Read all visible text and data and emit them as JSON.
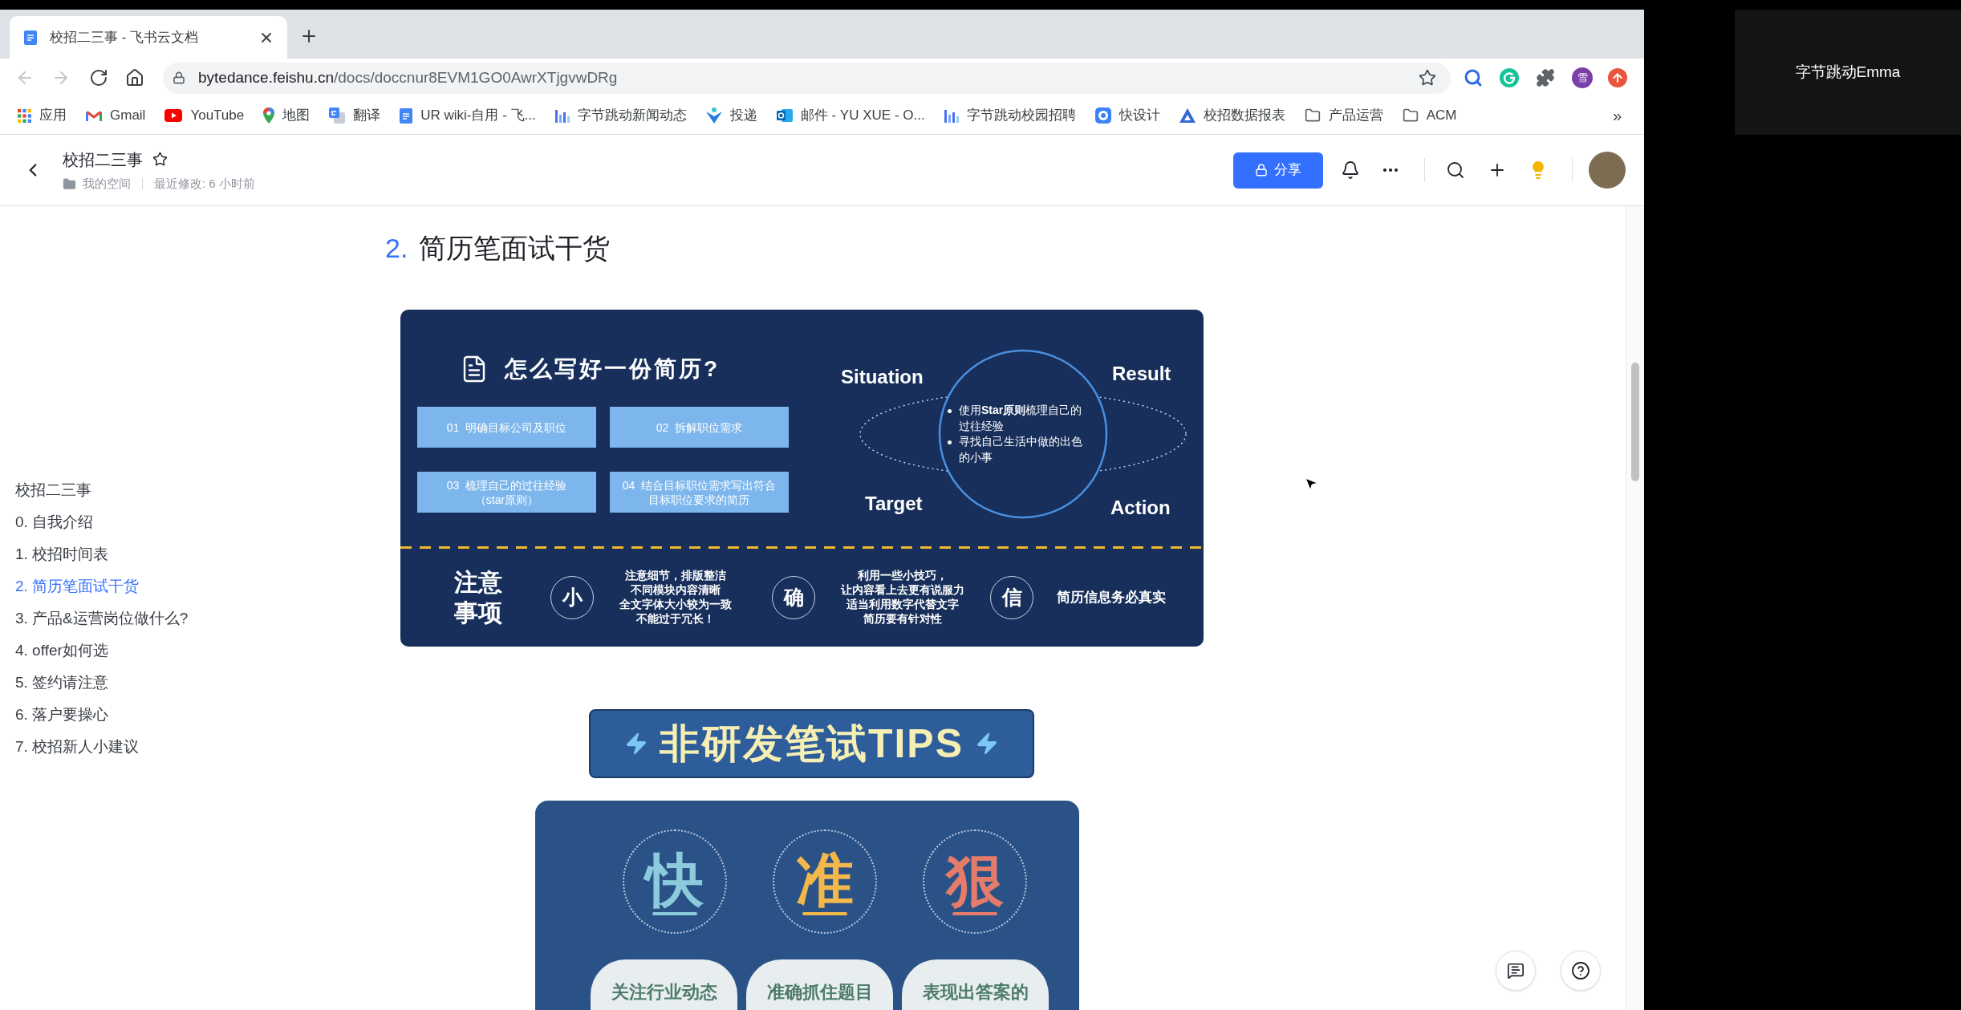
{
  "browser": {
    "tabs": [
      {
        "title": "校招二三事 - 飞书云文档",
        "selected": true
      }
    ],
    "toolbar": {
      "back": {
        "disabled": true
      },
      "forward": {
        "disabled": true
      },
      "url": {
        "host": "bytedance.feishu.cn",
        "path": "/docs/doccnur8EVM1GO0AwrXTjgvwDRg"
      },
      "profile_initial": "雪"
    },
    "bookmarks": [
      {
        "kind": "apps",
        "label": "应用"
      },
      {
        "kind": "mail",
        "label": "Gmail"
      },
      {
        "kind": "video",
        "label": "YouTube"
      },
      {
        "kind": "map",
        "label": "地图"
      },
      {
        "kind": "translate",
        "label": "翻译"
      },
      {
        "kind": "doc",
        "label": "UR wiki-自用 - 飞..."
      },
      {
        "kind": "chart",
        "label": "字节跳动新闻动态"
      },
      {
        "kind": "send",
        "label": "投递"
      },
      {
        "kind": "outlook",
        "label": "邮件 - YU XUE - O..."
      },
      {
        "kind": "chart",
        "label": "字节跳动校园招聘"
      },
      {
        "kind": "design",
        "label": "快设计"
      },
      {
        "kind": "drive",
        "label": "校招数据报表"
      },
      {
        "kind": "folder",
        "label": "产品运营"
      },
      {
        "kind": "folder",
        "label": "ACM"
      }
    ],
    "bookmarks_more": "»"
  },
  "doc_header": {
    "title": "校招二三事",
    "location": "我的空间",
    "modified": "最近修改: 6 小时前",
    "share_button": "分享"
  },
  "outline": [
    {
      "label": "校招二三事",
      "selected": false
    },
    {
      "label": "0. 自我介绍",
      "selected": false
    },
    {
      "label": "1. 校招时间表",
      "selected": false
    },
    {
      "label": "2. 简历笔面试干货",
      "selected": true
    },
    {
      "label": "3. 产品&运营岗位做什么?",
      "selected": false
    },
    {
      "label": "4. offer如何选",
      "selected": false
    },
    {
      "label": "5. 签约请注意",
      "selected": false
    },
    {
      "label": "6. 落户要操心",
      "selected": false
    },
    {
      "label": "7. 校招新人小建议",
      "selected": false
    }
  ],
  "heading": {
    "number": "2.",
    "text": "简历笔面试干货"
  },
  "resume_card": {
    "title": "怎么写好一份简历?",
    "steps": [
      {
        "lines": [
          "01  明确目标公司及职位"
        ]
      },
      {
        "lines": [
          "02  拆解职位需求"
        ]
      },
      {
        "lines": [
          "03  梳理自己的过往经验",
          "（star原则）"
        ]
      },
      {
        "lines": [
          "04  结合目标职位需求写出符合",
          "目标职位要求的简历"
        ]
      }
    ],
    "star": {
      "situation": "Situation",
      "result": "Result",
      "target": "Target",
      "action": "Action",
      "bullets": [
        {
          "lines": [
            "使用**Star原则**梳理自己的",
            "过往经验"
          ]
        },
        {
          "lines": [
            "寻找自己生活中做的出色",
            "的小事"
          ]
        }
      ]
    },
    "notes": {
      "heading_lines": [
        "注意",
        "事项"
      ],
      "items": [
        {
          "mark": "小",
          "lines": [
            "注意细节，排版整洁",
            "不同模块内容清晰",
            "全文字体大小较为一致",
            "不能过于冗长！"
          ]
        },
        {
          "mark": "确",
          "lines": [
            "利用一些小技巧，",
            "让内容看上去更有说服力",
            "适当利用数字代替文字",
            "简历要有针对性"
          ]
        },
        {
          "mark": "信",
          "lines": [
            "简历信息务必**真实**"
          ]
        }
      ]
    }
  },
  "tips_banner": {
    "title": "非研发笔试TIPS"
  },
  "tips_card": {
    "items": [
      {
        "character": "快",
        "color": "#8ccbdc",
        "caption": "关注行业动态"
      },
      {
        "character": "准",
        "color": "#f2b84b",
        "caption": "准确抓住题目"
      },
      {
        "character": "狠",
        "color": "#e57c6a",
        "caption": "表现出答案的"
      }
    ]
  },
  "call": {
    "participant": "字节跳动Emma"
  }
}
